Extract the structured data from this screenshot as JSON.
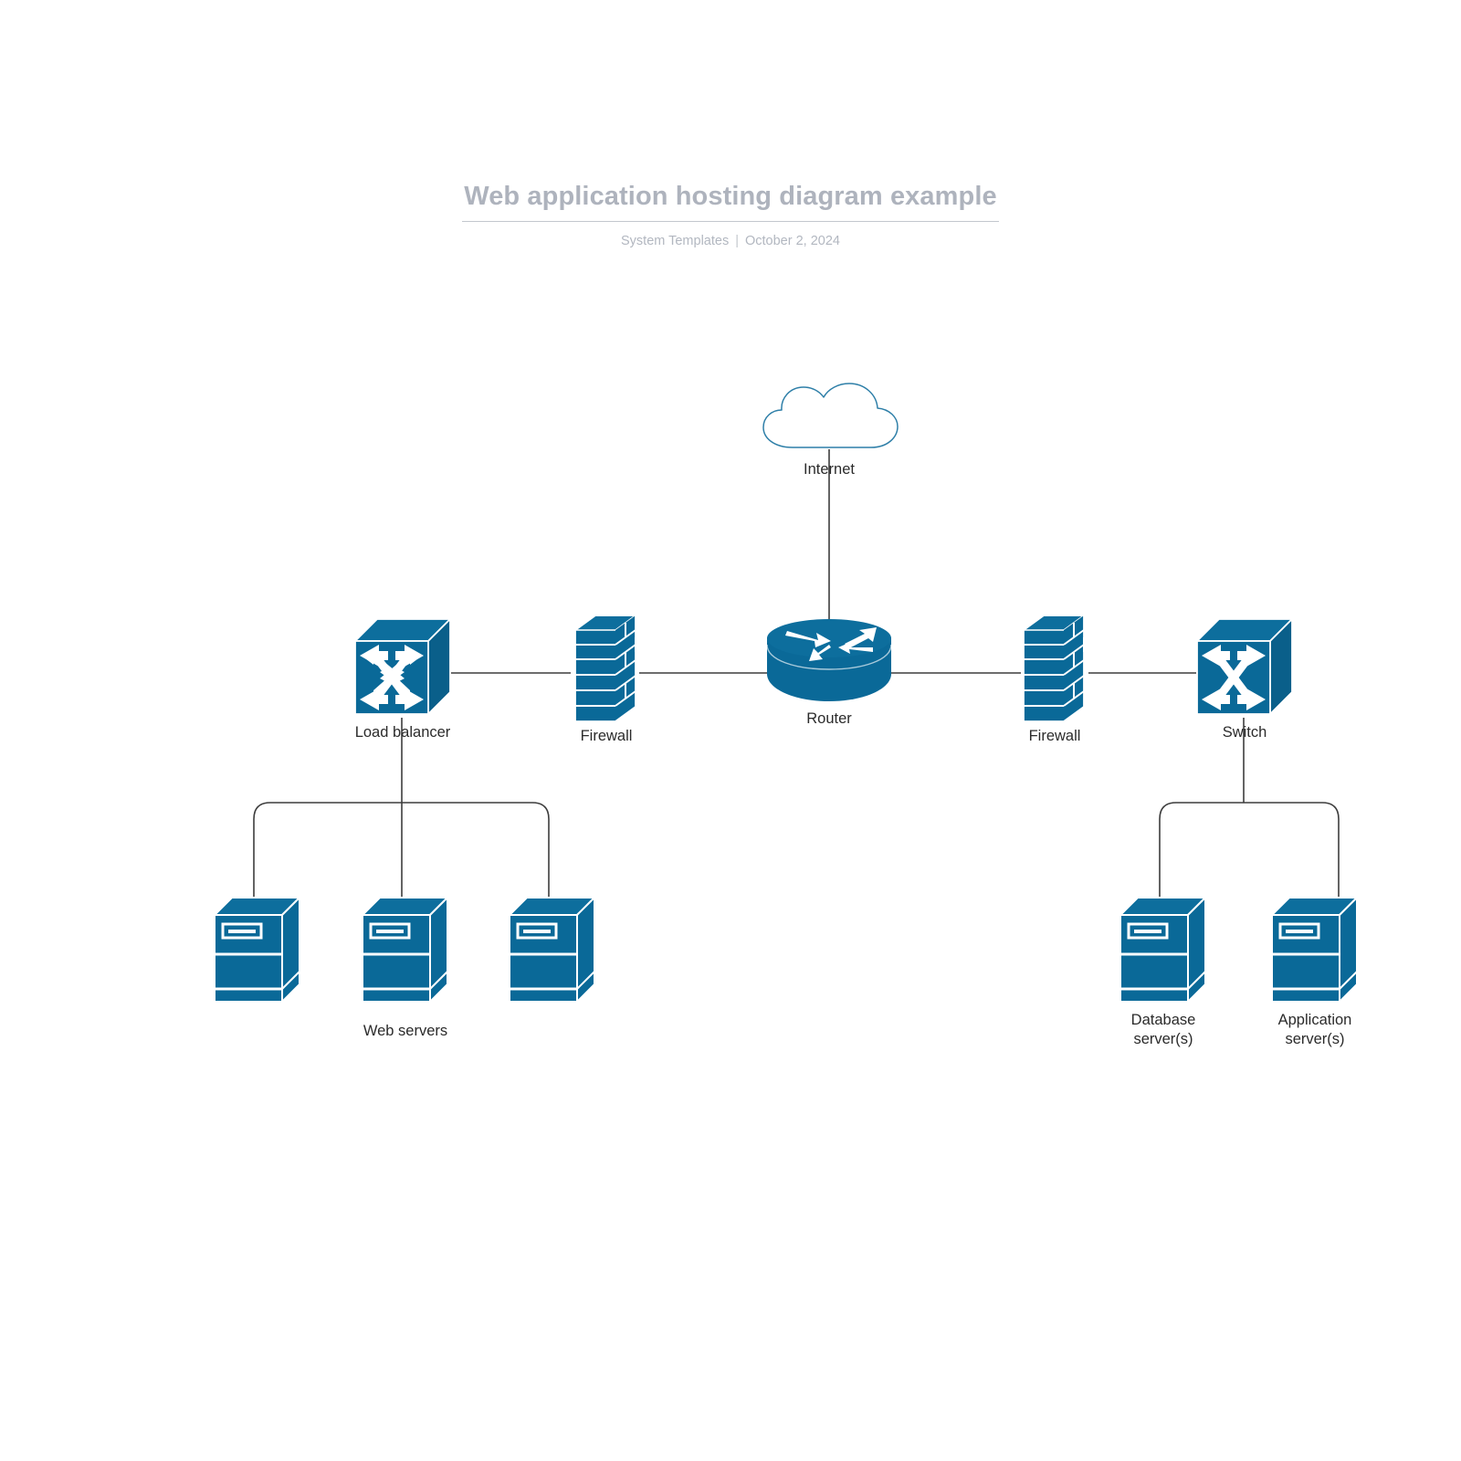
{
  "header": {
    "title": "Web application hosting diagram example",
    "author": "System Templates",
    "separator": "|",
    "date": "October 2, 2024"
  },
  "diagram": {
    "title": "Web application hosting diagram example",
    "accent_color": "#0a6998",
    "accent_dark": "#0a5f8a",
    "accent_top": "#0d6e9d",
    "line_color": "#3d3d3d",
    "cloud_stroke": "#2e7fa8",
    "nodes": [
      {
        "id": "internet",
        "icon": "cloud-icon",
        "label": "Internet"
      },
      {
        "id": "router",
        "icon": "router-icon",
        "label": "Router"
      },
      {
        "id": "firewall_left",
        "icon": "firewall-icon",
        "label": "Firewall"
      },
      {
        "id": "firewall_right",
        "icon": "firewall-icon",
        "label": "Firewall"
      },
      {
        "id": "load_balancer",
        "icon": "switch-icon",
        "label": "Load balancer"
      },
      {
        "id": "switch",
        "icon": "switch-icon",
        "label": "Switch"
      },
      {
        "id": "web_server_1",
        "icon": "server-icon",
        "label": ""
      },
      {
        "id": "web_server_2",
        "icon": "server-icon",
        "label": ""
      },
      {
        "id": "web_server_3",
        "icon": "server-icon",
        "label": ""
      },
      {
        "id": "web_servers_group",
        "icon": "group-label",
        "label": "Web servers"
      },
      {
        "id": "database_server",
        "icon": "server-icon",
        "label_line1": "Database",
        "label_line2": "server(s)"
      },
      {
        "id": "application_server",
        "icon": "server-icon",
        "label_line1": "Application",
        "label_line2": "server(s)"
      }
    ],
    "labels": {
      "internet": "Internet",
      "router": "Router",
      "firewall_left": "Firewall",
      "firewall_right": "Firewall",
      "load_balancer": "Load balancer",
      "switch": "Switch",
      "web_servers": "Web servers",
      "database_server_l1": "Database",
      "database_server_l2": "server(s)",
      "application_server_l1": "Application",
      "application_server_l2": "server(s)"
    },
    "connections": [
      {
        "from": "internet",
        "to": "router"
      },
      {
        "from": "router",
        "to": "firewall_left"
      },
      {
        "from": "firewall_left",
        "to": "load_balancer"
      },
      {
        "from": "router",
        "to": "firewall_right"
      },
      {
        "from": "firewall_right",
        "to": "switch"
      },
      {
        "from": "load_balancer",
        "to": "web_server_1"
      },
      {
        "from": "load_balancer",
        "to": "web_server_2"
      },
      {
        "from": "load_balancer",
        "to": "web_server_3"
      },
      {
        "from": "switch",
        "to": "database_server"
      },
      {
        "from": "switch",
        "to": "application_server"
      }
    ]
  }
}
